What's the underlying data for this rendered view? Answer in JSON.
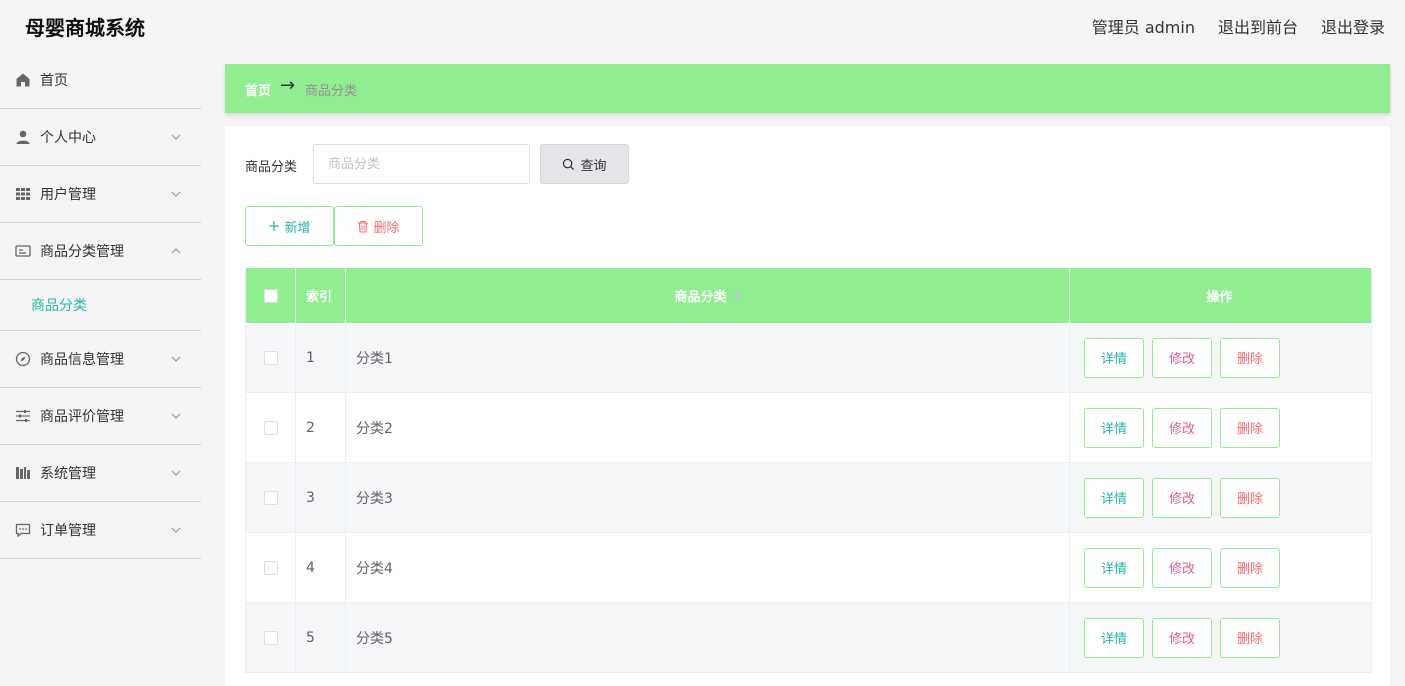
{
  "header": {
    "app_title": "母婴商城系统",
    "admin_label": "管理员 admin",
    "exit_front": "退出到前台",
    "logout": "退出登录"
  },
  "sidebar": {
    "items": [
      {
        "label": "首页",
        "icon": "home-icon"
      },
      {
        "label": "个人中心",
        "icon": "user-icon"
      },
      {
        "label": "用户管理",
        "icon": "grid-icon"
      },
      {
        "label": "商品分类管理",
        "icon": "card-icon",
        "expanded": true
      },
      {
        "label": "商品信息管理",
        "icon": "compass-icon"
      },
      {
        "label": "商品评价管理",
        "icon": "sliders-icon"
      },
      {
        "label": "系统管理",
        "icon": "books-icon"
      },
      {
        "label": "订单管理",
        "icon": "chat-icon"
      }
    ],
    "submenu_active": "商品分类"
  },
  "breadcrumb": {
    "home": "首页",
    "arrow": "→",
    "current": "商品分类"
  },
  "search": {
    "label": "商品分类",
    "placeholder": "商品分类",
    "query_button": "查询"
  },
  "actions": {
    "add": "新增",
    "delete": "删除"
  },
  "table": {
    "headers": {
      "index": "索引",
      "category": "商品分类",
      "operation": "操作"
    },
    "rows": [
      {
        "index": "1",
        "category": "分类1"
      },
      {
        "index": "2",
        "category": "分类2"
      },
      {
        "index": "3",
        "category": "分类3"
      },
      {
        "index": "4",
        "category": "分类4"
      },
      {
        "index": "5",
        "category": "分类5"
      }
    ],
    "op_labels": {
      "detail": "详情",
      "edit": "修改",
      "delete": "删除"
    }
  },
  "colors": {
    "accent": "#90ee90",
    "teal": "#23b7a9",
    "pink": "#e75a93",
    "red": "#f56c6c"
  }
}
